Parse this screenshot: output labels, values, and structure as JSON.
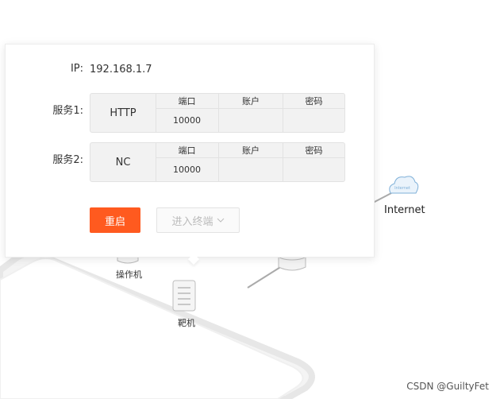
{
  "popup": {
    "ip_label": "IP:",
    "ip_value": "192.168.1.7",
    "services": [
      {
        "label": "服务1:",
        "name": "HTTP",
        "columns": [
          "端口",
          "账户",
          "密码"
        ],
        "values": [
          "10000",
          "",
          ""
        ]
      },
      {
        "label": "服务2:",
        "name": "NC",
        "columns": [
          "端口",
          "账户",
          "密码"
        ],
        "values": [
          "10000",
          "",
          ""
        ]
      }
    ],
    "restart_label": "重启",
    "terminal_label": "进入终端",
    "terminal_state": "disabled"
  },
  "network": {
    "internet_label": "Internet",
    "internet_icon_text": "Internet",
    "operator_label": "操作机",
    "target_label": "靶机"
  },
  "watermark": "CSDN @GuiltyFet",
  "colors": {
    "accent": "#ff5a1f",
    "table_bg": "#f2f2f2",
    "border": "#e2e2e2"
  }
}
